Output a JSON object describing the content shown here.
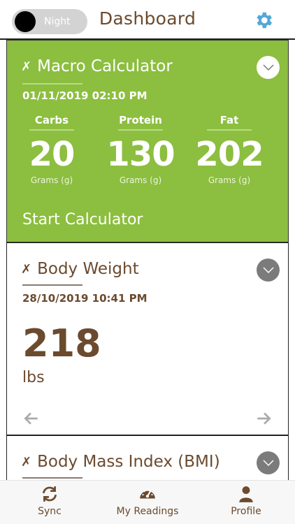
{
  "header": {
    "night_label": "Night",
    "title": "Dashboard",
    "settings_icon": "gear-icon"
  },
  "colors": {
    "accent_green": "#8cbe3f",
    "brand_brown": "#6b4a2e",
    "settings_blue": "#4fa8d8",
    "chevron_grey": "#7b7b7b"
  },
  "macro_card": {
    "title": "Macro Calculator",
    "date": "01/11/2019 02:10 PM",
    "columns": [
      {
        "label": "Carbs",
        "value": "20",
        "unit": "Grams (g)"
      },
      {
        "label": "Protein",
        "value": "130",
        "unit": "Grams (g)"
      },
      {
        "label": "Fat",
        "value": "202",
        "unit": "Grams (g)"
      }
    ],
    "action": "Start Calculator"
  },
  "weight_card": {
    "title": "Body Weight",
    "date": "28/10/2019 10:41 PM",
    "value": "218",
    "unit": "lbs"
  },
  "bmi_card": {
    "title": "Body Mass Index (BMI)"
  },
  "tabbar": {
    "tabs": [
      {
        "label": "Sync",
        "icon": "sync-icon"
      },
      {
        "label": "My Readings",
        "icon": "gauge-icon"
      },
      {
        "label": "Profile",
        "icon": "person-icon"
      }
    ]
  }
}
